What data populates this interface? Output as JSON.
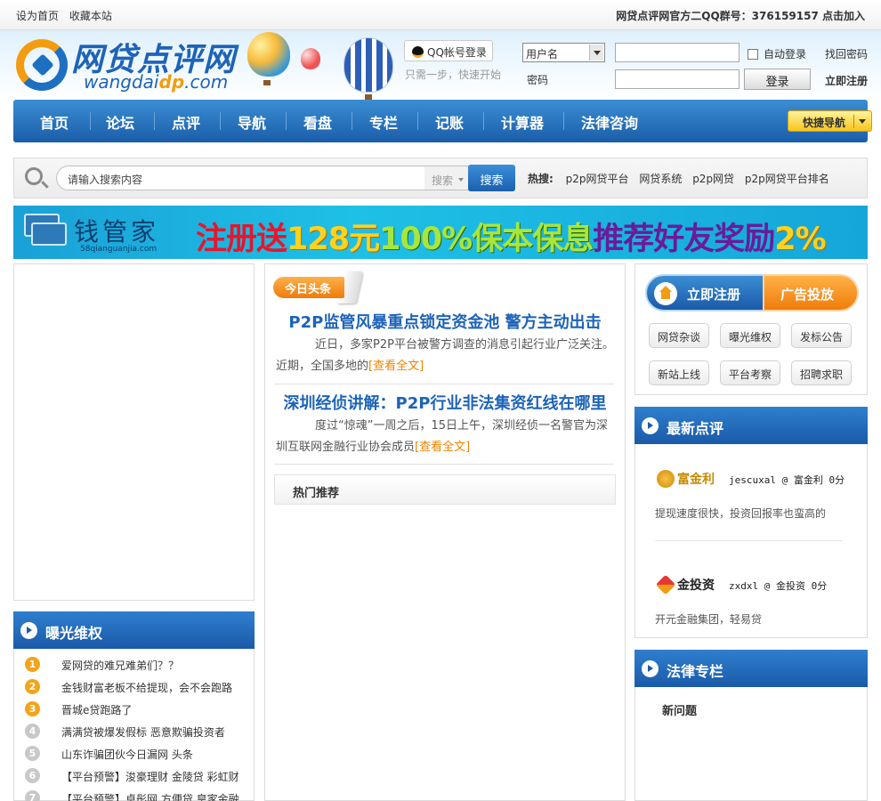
{
  "topbar": {
    "set_home": "设为首页",
    "bookmark": "收藏本站",
    "qq_group": "网贷点评网官方二QQ群号：376159157 点击加入"
  },
  "header": {
    "logo_cn": "网贷点评网",
    "logo_en_prefix": "wangdai",
    "logo_en_highlight": "dp",
    "logo_en_suffix": ".com",
    "qq_login": "QQ帐号登录",
    "qq_tip": "只需一步，快速开始",
    "username_select": "用户名",
    "password_label": "密码",
    "auto_login": "自动登录",
    "login_button": "登录",
    "find_password": "找回密码",
    "register_now": "立即注册"
  },
  "nav": {
    "items": [
      "首页",
      "论坛",
      "点评",
      "导航",
      "看盘",
      "专栏",
      "记账",
      "计算器",
      "法律咨询"
    ],
    "quick_nav": "快捷导航"
  },
  "search": {
    "placeholder": "请输入搜索内容",
    "type": "搜索",
    "button": "搜索",
    "hot_label": "热搜:",
    "hot_keywords": [
      "p2p网贷平台",
      "网贷系统",
      "p2p网贷",
      "p2p网贷平台排名"
    ]
  },
  "banner": {
    "brand": "钱管家",
    "brand_url": "58qianguanjia.com",
    "slogan_1": "注册送",
    "slogan_2": "128元",
    "slogan_3": "100%",
    "slogan_4": "保本保息",
    "slogan_5": "推荐好友奖励",
    "slogan_6": "2%"
  },
  "exposure": {
    "title": "曝光维权",
    "items": [
      {
        "num": "1",
        "text": "爱网贷的难兄难弟们？？"
      },
      {
        "num": "2",
        "text": "金钱财富老板不给提现，会不会跑路"
      },
      {
        "num": "3",
        "text": "晋城e贷跑路了"
      },
      {
        "num": "4",
        "text": "满满贷被爆发假标 恶意欺骗投资者"
      },
      {
        "num": "5",
        "text": "山东诈骗团伙今日漏网 头条"
      },
      {
        "num": "6",
        "text": "【平台预警】浚豪理财 金陵贷 彩虹财"
      },
      {
        "num": "7",
        "text": "【平台预警】卓彤网 方便贷 皇家金融"
      }
    ]
  },
  "headlines": {
    "ribbon": "今日头条",
    "news": [
      {
        "title": "P2P监管风暴重点锁定资金池 警方主动出击",
        "summary": "近日，多家P2P平台被警方调查的消息引起行业广泛关注。　　近期，全国多地的",
        "more": "[查看全文]"
      },
      {
        "title": "深圳经侦讲解：P2P行业非法集资红线在哪里",
        "summary": "度过“惊魂”一周之后，15日上午，深圳经侦一名警官为深圳互联网金融行业协会成员",
        "more": "[查看全文]"
      }
    ],
    "hot_recommend": "热门推荐"
  },
  "right": {
    "register_btn": "立即注册",
    "ad_btn": "广告投放",
    "tags": [
      "网贷杂谈",
      "曝光维权",
      "发标公告",
      "新站上线",
      "平台考察",
      "招聘求职"
    ]
  },
  "latest_reviews": {
    "title": "最新点评",
    "items": [
      {
        "logo": "富金利",
        "user": "jescuxal @ 富金利 0分",
        "comment": "提现速度很快，投资回报率也蛮高的"
      },
      {
        "logo": "金投资",
        "user": "zxdxl @ 金投资 0分",
        "comment": "开元金融集团，轻易贷"
      }
    ]
  },
  "law": {
    "title": "法律专栏",
    "new_question": "新问题"
  }
}
